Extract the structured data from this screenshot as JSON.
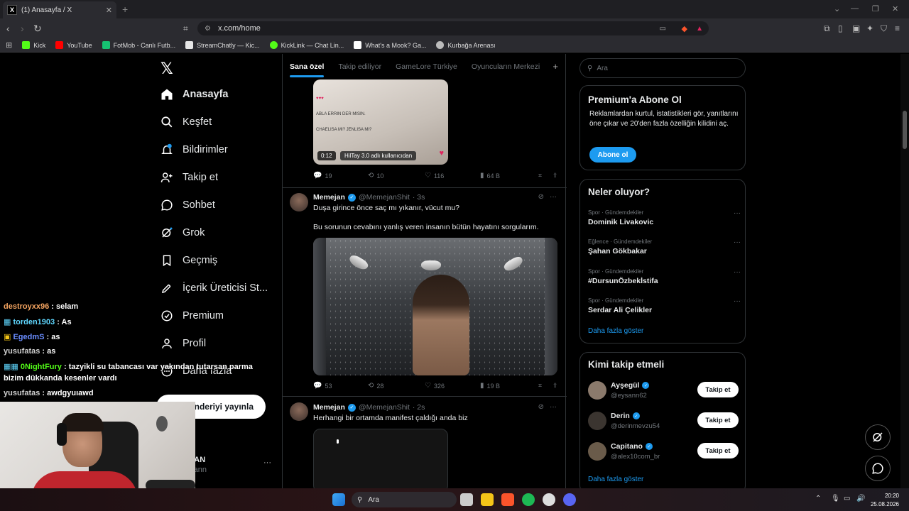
{
  "browser": {
    "tab_title": "(1) Anasayfa / X",
    "url": "x.com/home",
    "bookmarks": [
      {
        "label": "Kick",
        "color": "#53fc18"
      },
      {
        "label": "YouTube",
        "color": "#ff0000"
      },
      {
        "label": "FotMob - Canlı Futb...",
        "color": "#16c172"
      },
      {
        "label": "StreamChatly — Kic...",
        "color": "#e6e6e6"
      },
      {
        "label": "KickLink — Chat Lin...",
        "color": "#53fc18"
      },
      {
        "label": "What's a Mook? Ga...",
        "color": "#ffffff"
      },
      {
        "label": "Kurbağa Arenası",
        "color": "#bbbbbb"
      }
    ]
  },
  "nav": {
    "items": [
      {
        "label": "Anasayfa",
        "icon": "home-icon",
        "active": true
      },
      {
        "label": "Keşfet",
        "icon": "search-icon"
      },
      {
        "label": "Bildirimler",
        "icon": "bell-icon"
      },
      {
        "label": "Takip et",
        "icon": "follow-icon"
      },
      {
        "label": "Sohbet",
        "icon": "chat-icon"
      },
      {
        "label": "Grok",
        "icon": "grok-icon"
      },
      {
        "label": "Geçmiş",
        "icon": "bookmark-icon"
      },
      {
        "label": "İçerik Üreticisi St...",
        "icon": "rocket-icon"
      },
      {
        "label": "Premium",
        "icon": "premium-icon"
      },
      {
        "label": "Profil",
        "icon": "profile-icon"
      },
      {
        "label": "Daha fazla",
        "icon": "more-icon"
      }
    ],
    "post_button": "Gönderiyi yayınla",
    "account_name": "LGAN",
    "account_handle": "algann"
  },
  "timeline": {
    "tabs": [
      "Sana özel",
      "Takip ediliyor",
      "GameLore Türkiye",
      "Oyuncuların Merkezi"
    ],
    "post1": {
      "video_time": "0:12",
      "overlay_caption": "HilTay 3.0 adlı kullanıcıdan",
      "overlay_lines": [
        "ABLA ERRIN DER MISIN.",
        "CHAELISA MI? JENLISA MI?"
      ],
      "replies": "19",
      "reposts": "10",
      "likes": "116",
      "views": "64 B"
    },
    "post2": {
      "name": "Memejan",
      "handle": "@MemejanShit",
      "time": "· 3s",
      "text1": "Duşa girince önce saç mı yıkanır, vücut mu?",
      "text2": "Bu sorunun cevabını yanlış veren insanın bütün hayatını sorgularım.",
      "replies": "53",
      "reposts": "28",
      "likes": "326",
      "views": "19 B"
    },
    "post3": {
      "name": "Memejan",
      "handle": "@MemejanShit",
      "time": "· 2s",
      "text1": "Herhangi bir ortamda manifest çaldığı anda biz"
    }
  },
  "sidebar": {
    "search_placeholder": "Ara",
    "premium": {
      "title": "Premium'a Abone Ol",
      "text": "Reklamlardan kurtul, istatistikleri gör, yanıtlarını öne çıkar ve 20'den fazla özelliğin kilidini aç.",
      "button": "Abone ol"
    },
    "trends": {
      "title": "Neler oluyor?",
      "items": [
        {
          "category": "Spor · Gündemdekiler",
          "topic": "Dominik Livakovic"
        },
        {
          "category": "Eğlence · Gündemdekiler",
          "topic": "Şahan Gökbakar"
        },
        {
          "category": "Spor · Gündemdekiler",
          "topic": "#DursunÖzbekİstifa"
        },
        {
          "category": "Spor · Gündemdekiler",
          "topic": "Serdar Ali Çelikler"
        }
      ],
      "show_more": "Daha fazla göster"
    },
    "who_to_follow": {
      "title": "Kimi takip etmeli",
      "users": [
        {
          "name": "Ayşegül",
          "handle": "@eysann62",
          "button": "Takip et",
          "color": "#8b7a6c"
        },
        {
          "name": "Derin",
          "handle": "@derinmevzu54",
          "button": "Takip et",
          "color": "#3b3530"
        },
        {
          "name": "Capitano",
          "handle": "@alex10com_br",
          "button": "Takip et",
          "color": "#6a5b4a"
        }
      ],
      "show_more": "Daha fazla göster"
    }
  },
  "stream_chat": [
    {
      "user": "destroyxx96",
      "msg": ": selam",
      "color": "#f4a460"
    },
    {
      "user": "torden1903",
      "msg": ": As",
      "color": "#5fd7ff"
    },
    {
      "user": "EgedmS",
      "msg": ": as",
      "color": "#6a8dff"
    },
    {
      "user": "yusufatas",
      "msg": ": as",
      "color": "#cfcfcf"
    },
    {
      "user": "0NightFury",
      "msg": ": tazyikli su tabancası var yakından tutarsan parma",
      "color": "#53fc18"
    },
    {
      "user": "",
      "msg": "bizim dükkanda kesenler vardı",
      "color": "#ffffff"
    },
    {
      "user": "yusufatas",
      "msg": ": awdgyuıawd",
      "color": "#cfcfcf"
    }
  ],
  "taskbar": {
    "search": "Ara",
    "time": "20:20",
    "date": "25.08.2026"
  }
}
